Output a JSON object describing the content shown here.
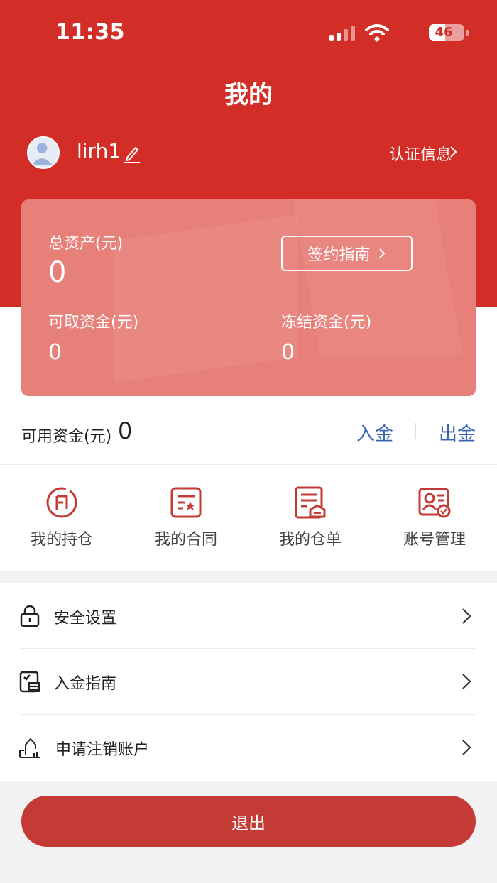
{
  "status_bar": {
    "time": "11:35",
    "battery": "46",
    "battery_level": 0.46
  },
  "header": {
    "title": "我的"
  },
  "profile": {
    "username": "lirh1",
    "cert_link": "认证信息"
  },
  "assets": {
    "total_label": "总资产(元)",
    "total_value": "0",
    "sign_guide_label": "签约指南",
    "withdrawable_label": "可取资金(元)",
    "withdrawable_value": "0",
    "frozen_label": "冻结资金(元)",
    "frozen_value": "0"
  },
  "funds": {
    "available_label": "可用资金(元)",
    "available_value": "0",
    "deposit_label": "入金",
    "withdraw_label": "出金"
  },
  "quick_actions": [
    {
      "label": "我的持仓",
      "icon": "position-icon"
    },
    {
      "label": "我的合同",
      "icon": "contract-icon"
    },
    {
      "label": "我的仓单",
      "icon": "warehouse-receipt-icon"
    },
    {
      "label": "账号管理",
      "icon": "account-manage-icon"
    }
  ],
  "menu": [
    {
      "label": "安全设置",
      "icon": "lock-icon"
    },
    {
      "label": "入金指南",
      "icon": "deposit-guide-icon"
    },
    {
      "label": "申请注销账户",
      "icon": "cancel-account-icon"
    }
  ],
  "logout_label": "退出",
  "colors": {
    "brand_red": "#d22d26",
    "link_blue": "#3c66b5",
    "card_pink": "#e8807a"
  }
}
